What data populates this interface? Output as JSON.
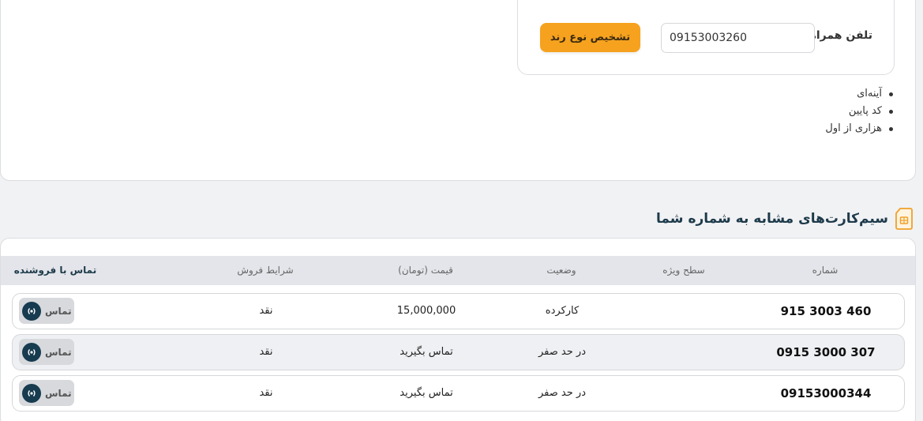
{
  "search": {
    "phone_label": "تلفن همراه",
    "phone_value": "09153003260",
    "detect_button": "تشخیص نوع رند"
  },
  "tags": [
    "آینه‌ای",
    "کد پایین",
    "هزاری از اول"
  ],
  "section": {
    "title": "سیم‌کارت‌های مشابه به شماره شما",
    "icon": "sim-card-icon"
  },
  "table": {
    "headers": {
      "number": "شماره",
      "level": "سطح ویژه",
      "status": "وضعیت",
      "price": "قیمت (تومان)",
      "terms": "شرایط فروش",
      "contact": "تماس با فروشنده"
    },
    "rows": [
      {
        "number": "915 3003 460",
        "level": "",
        "status": "کارکرده",
        "price": "15,000,000",
        "terms": "نقد",
        "contact": "تماس"
      },
      {
        "number": "0915 3000 307",
        "level": "",
        "status": "در حد صفر",
        "price": "تماس بگیرید",
        "terms": "نقد",
        "contact": "تماس"
      },
      {
        "number": "09153000344",
        "level": "",
        "status": "در حد صفر",
        "price": "تماس بگیرید",
        "terms": "نقد",
        "contact": "تماس"
      }
    ]
  },
  "colors": {
    "accent": "#f6a21e",
    "header_bg": "#e3e5ea",
    "title": "#1d3a4a",
    "call_icon_bg": "#173b4f"
  }
}
